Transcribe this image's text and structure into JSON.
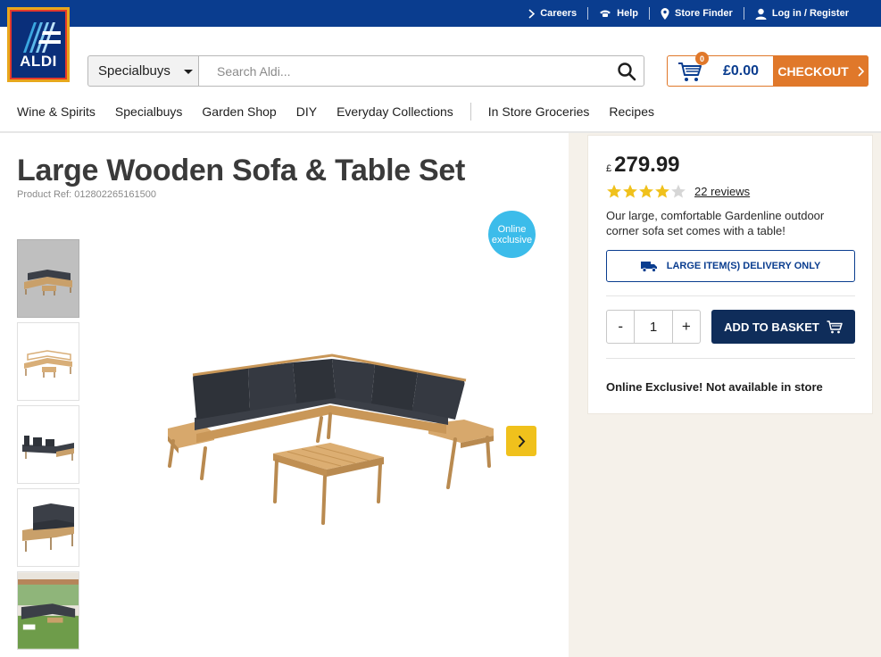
{
  "topbar": {
    "careers": "Careers",
    "help": "Help",
    "store_finder": "Store Finder",
    "login": "Log in / Register"
  },
  "logo": {
    "text": "ALDI"
  },
  "search": {
    "category": "Specialbuys",
    "placeholder": "Search Aldi..."
  },
  "cart": {
    "count": "0",
    "total": "£0.00",
    "checkout": "CHECKOUT"
  },
  "nav": {
    "items": [
      "Wine & Spirits",
      "Specialbuys",
      "Garden Shop",
      "DIY",
      "Everyday Collections",
      "In Store Groceries",
      "Recipes"
    ]
  },
  "product": {
    "title": "Large Wooden Sofa & Table Set",
    "ref": "Product Ref: 012802265161500",
    "badge_line1": "Online",
    "badge_line2": "exclusive",
    "thumb_count": 5
  },
  "buybox": {
    "currency": "£",
    "price": "279.99",
    "rating": 4,
    "reviews": "22 reviews",
    "description": "Our large, comfortable Gardenline outdoor corner sofa set comes with a table!",
    "delivery": "LARGE ITEM(S) DELIVERY ONLY",
    "qty_minus": "-",
    "qty": "1",
    "qty_plus": "+",
    "add_to_basket": "ADD TO BASKET",
    "note": "Online Exclusive! Not available in store"
  },
  "colors": {
    "brand_blue": "#0a3d8f",
    "checkout_orange": "#e0782a",
    "badge_blue": "#3cbcea",
    "arrow_yellow": "#f0c11c",
    "basket_navy": "#0f2d5a",
    "star_gold": "#f0c11c"
  }
}
